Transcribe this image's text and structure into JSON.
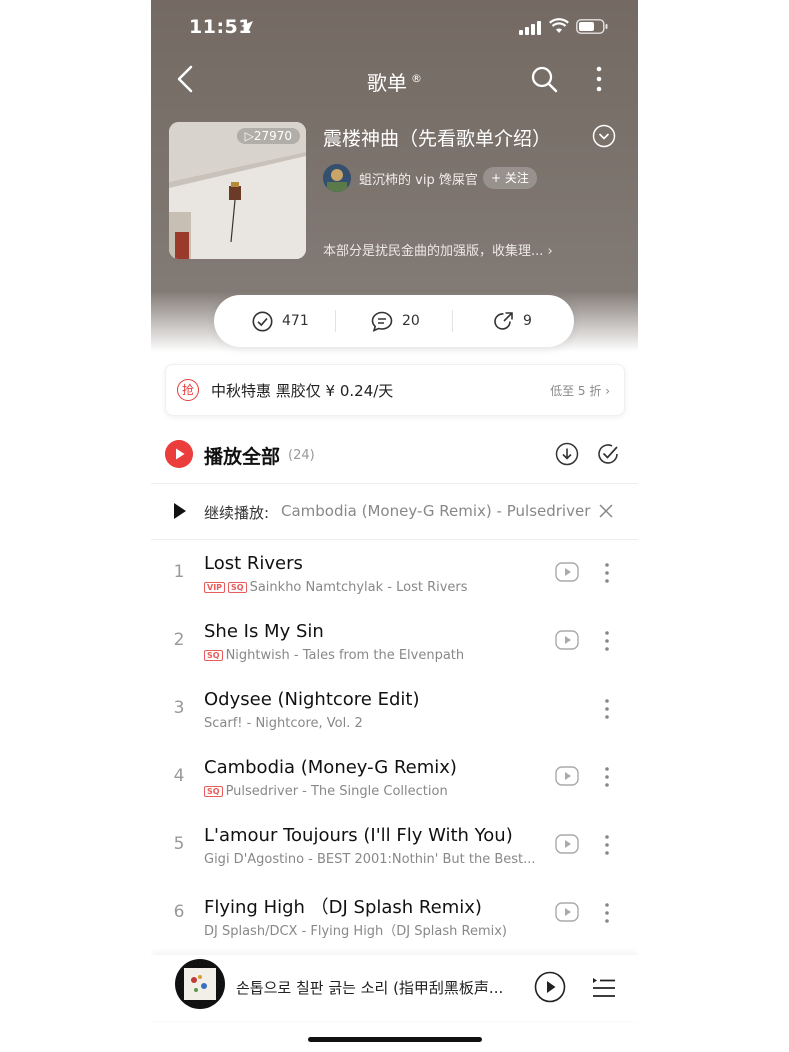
{
  "status_bar": {
    "time": "11:51"
  },
  "nav": {
    "title": "歌单",
    "title_mark": "®"
  },
  "playlist": {
    "play_count": "▷27970",
    "title": "震楼神曲（先看歌单介绍）",
    "owner": "蛆沉柿的 vip 馋屎官",
    "follow_label": "+ 关注",
    "description": "本部分是扰民金曲的加强版，收集理..."
  },
  "stats": {
    "collect": "471",
    "comments": "20",
    "shares": "9"
  },
  "promo": {
    "icon_text": "抢",
    "text": "中秋特惠 黑胶仅 ¥ 0.24/天",
    "more": "低至 5 折"
  },
  "play_all": {
    "label": "播放全部",
    "count": "(24)"
  },
  "continue": {
    "label": "继续播放:",
    "song": "Cambodia (Money-G Remix) - Pulsedriver"
  },
  "songs": [
    {
      "index": "1",
      "title": "Lost Rivers",
      "tags": [
        "VIP",
        "SQ"
      ],
      "subtitle": "Sainkho Namtchylak - Lost Rivers",
      "has_mv": true
    },
    {
      "index": "2",
      "title": "She Is My Sin",
      "tags": [
        "SQ"
      ],
      "subtitle": "Nightwish - Tales from the Elvenpath",
      "has_mv": true
    },
    {
      "index": "3",
      "title": "Odysee (Nightcore Edit)",
      "tags": [],
      "subtitle": "Scarf! - Nightcore, Vol. 2",
      "has_mv": false
    },
    {
      "index": "4",
      "title": "Cambodia (Money-G Remix)",
      "tags": [
        "SQ"
      ],
      "subtitle": "Pulsedriver - The Single Collection",
      "has_mv": true
    },
    {
      "index": "5",
      "title": "L'amour Toujours (I'll Fly With You)",
      "tags": [],
      "subtitle": "Gigi D'Agostino - BEST 2001:Nothin' But the Best...",
      "has_mv": true
    },
    {
      "index": "6",
      "title": "Flying High （DJ Splash Remix)",
      "tags": [],
      "subtitle": "DJ Splash/DCX - Flying High（DJ Splash Remix)",
      "has_mv": true
    }
  ],
  "mini_player": {
    "title": "손톱으로 칠판 긁는 소리 (指甲刮黑板声..."
  },
  "colors": {
    "accent": "#ec3d3d",
    "hero": "#766c66"
  }
}
